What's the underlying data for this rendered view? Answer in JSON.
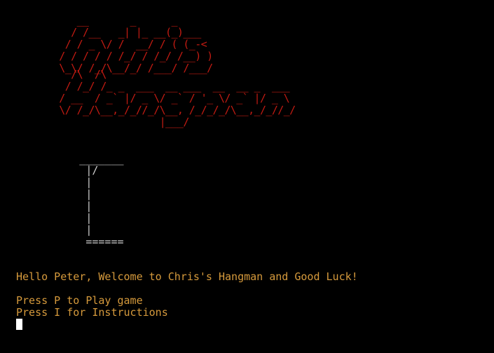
{
  "terminal": {
    "banner_lines": [
      "             __       _      _",
      "            / /__   _| |_ __(_)___",
      "           / / _ \\/ /  __/ / ( (_-<",
      "          / / / / / /_/ / /_/ /__) )",
      "          \\_\\/ /_/\\__/_/ /___/ /___/",
      "            /\\  /\\",
      "           / /_/ /_ _  ___  __ ___  __  __ _  ___",
      "          / __  / _` |/ _ \\/ _` / '_ \\/ _` |/ _ \\",
      "          \\/ /_/\\__,_/_//_/\\__, /_/_/_/\\__,_/_//_/",
      "                           |___/"
    ],
    "gallows_lines": [
      "          _______",
      "           |/",
      "           |",
      "           |",
      "           |",
      "           |",
      "           |",
      "           ======"
    ],
    "greeting": "Hello Peter, Welcome to Chris's Hangman and Good Luck!",
    "option_play": "Press P to Play game",
    "option_instructions": "Press I for Instructions"
  }
}
